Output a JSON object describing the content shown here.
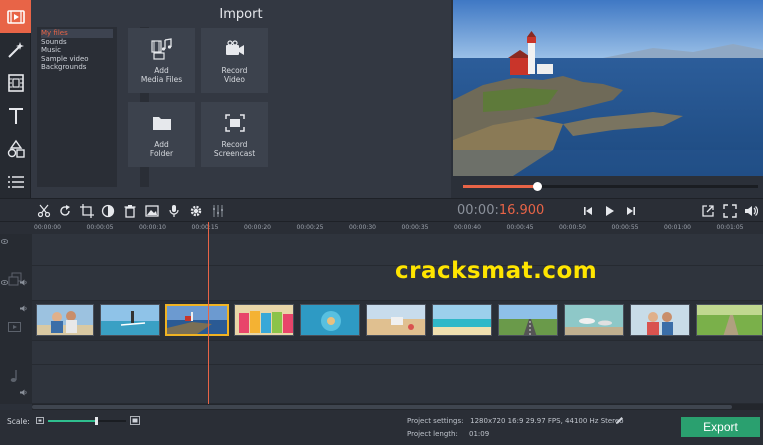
{
  "import": {
    "title": "Import",
    "files": [
      "My files",
      "Sounds",
      "Music",
      "Sample video",
      "Backgrounds"
    ],
    "collapse_glyph": "‹",
    "tiles": [
      {
        "label": "Add\nMedia Files",
        "icon": "media-files-icon"
      },
      {
        "label": "Record\nVideo",
        "icon": "camera-icon"
      },
      {
        "label": "Add\nFolder",
        "icon": "folder-icon"
      },
      {
        "label": "Record\nScreencast",
        "icon": "screencast-icon"
      }
    ]
  },
  "tools": [
    "import-icon",
    "magic-wand-icon",
    "filmstrip-icon",
    "text-icon",
    "shapes-icon",
    "list-icon"
  ],
  "preview": {
    "progress": 0.25
  },
  "timecode": {
    "static": "00:00:",
    "active": "16.900"
  },
  "ruler": [
    "00:00:00",
    "00:00:05",
    "00:00:10",
    "00:00:15",
    "00:00:20",
    "00:00:25",
    "00:00:30",
    "00:00:35",
    "00:00:40",
    "00:00:45",
    "00:00:50",
    "00:00:55",
    "00:01:00",
    "00:01:05"
  ],
  "watermark": "cracksmat.com",
  "scale": {
    "label": "Scale:",
    "value": 0.62
  },
  "project": {
    "settings_label": "Project settings:",
    "settings_value": "1280x720 16:9 29.97 FPS, 44100 Hz Stereo",
    "length_label": "Project length:",
    "length_value": "01:09"
  },
  "export_label": "Export",
  "colors": {
    "accent": "#e86447",
    "export": "#2aa06f",
    "selected_clip": "#f0b323",
    "watermark": "#ffe500"
  }
}
